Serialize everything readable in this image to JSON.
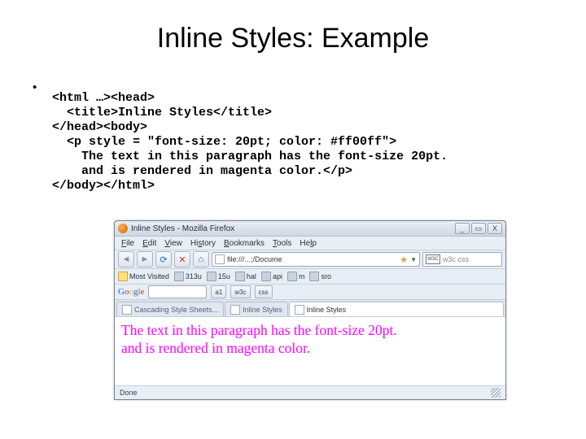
{
  "title": "Inline Styles: Example",
  "code": {
    "l1": "<html …><head>",
    "l2": "  <title>Inline Styles</title>",
    "l3": "</head><body>",
    "l4": "  <p style = \"font-size: 20pt; color: #ff00ff\">",
    "l5": "    The text in this paragraph has the font-size 20pt.",
    "l6": "    and is rendered in magenta color.</p>",
    "l7": "</body></html>"
  },
  "browser": {
    "window_title": "Inline Styles - Mozilla Firefox",
    "menus": {
      "file": "File",
      "edit": "Edit",
      "view": "View",
      "history": "History",
      "bookmarks": "Bookmarks",
      "tools": "Tools",
      "help": "Help"
    },
    "url": "file:///...;/Docume",
    "search_hint": "w3c css",
    "bookmarks_bar": {
      "most_visited": "Most Visited",
      "items": [
        "313u",
        "15u",
        "hal",
        "api",
        "m",
        "sro"
      ]
    },
    "google_bar": {
      "items": [
        "a1",
        "w3c",
        "css"
      ]
    },
    "tabs": {
      "t1": "Cascading Style Sheets...",
      "t2": "Inline Styles",
      "t3": "Inline Styles"
    },
    "paragraph_l1": "The text in this paragraph has the font-size 20pt.",
    "paragraph_l2": "and is rendered in magenta color.",
    "status": "Done"
  },
  "winbtns": {
    "min": "_",
    "max": "▭",
    "close": "X"
  }
}
